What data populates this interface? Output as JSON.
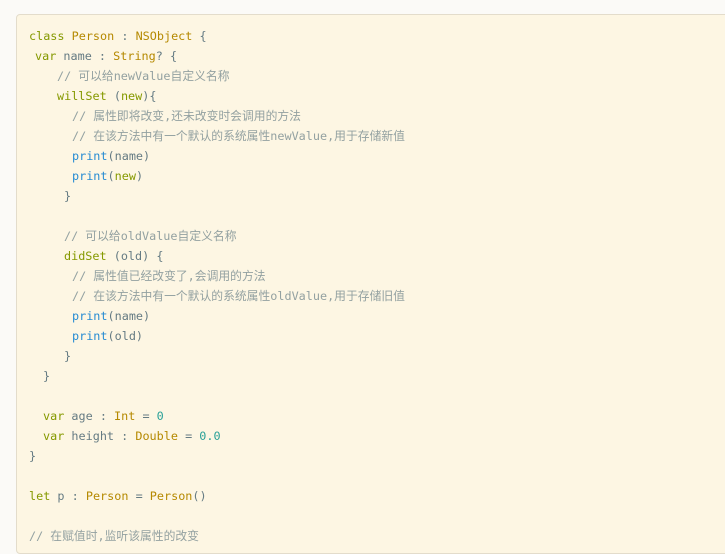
{
  "colors": {
    "keyword": "#859900",
    "type": "#b58900",
    "function": "#268bd2",
    "number": "#2aa198",
    "comment": "#93a1a1",
    "plain": "#657b83",
    "background": "#fdf6e3"
  },
  "code_lines": [
    {
      "indent": 0,
      "tokens": [
        [
          "kw",
          "class "
        ],
        [
          "ty",
          "Person"
        ],
        [
          "pl",
          " : "
        ],
        [
          "ty",
          "NSObject"
        ],
        [
          "pl",
          " {"
        ]
      ]
    },
    {
      "indent": 1,
      "tokens": [
        [
          "kw",
          "var "
        ],
        [
          "pl",
          "name : "
        ],
        [
          "ty",
          "String"
        ],
        [
          "pl",
          "? {"
        ]
      ]
    },
    {
      "indent": 4,
      "tokens": [
        [
          "cm",
          "// 可以给newValue自定义名称"
        ]
      ]
    },
    {
      "indent": 4,
      "tokens": [
        [
          "kw",
          "willSet "
        ],
        [
          "pl",
          "("
        ],
        [
          "kw",
          "new"
        ],
        [
          "pl",
          "){"
        ]
      ]
    },
    {
      "indent": 6,
      "tokens": [
        [
          "cm",
          "// 属性即将改变,还未改变时会调用的方法"
        ]
      ]
    },
    {
      "indent": 6,
      "tokens": [
        [
          "cm",
          "// 在该方法中有一个默认的系统属性newValue,用于存储新值"
        ]
      ]
    },
    {
      "indent": 6,
      "tokens": [
        [
          "fn",
          "print"
        ],
        [
          "pl",
          "(name)"
        ]
      ]
    },
    {
      "indent": 6,
      "tokens": [
        [
          "fn",
          "print"
        ],
        [
          "pl",
          "("
        ],
        [
          "kw",
          "new"
        ],
        [
          "pl",
          ")"
        ]
      ]
    },
    {
      "indent": 5,
      "tokens": [
        [
          "pl",
          "}"
        ]
      ]
    },
    {
      "indent": 0,
      "tokens": []
    },
    {
      "indent": 5,
      "tokens": [
        [
          "cm",
          "// 可以给oldValue自定义名称"
        ]
      ]
    },
    {
      "indent": 5,
      "tokens": [
        [
          "kw",
          "didSet "
        ],
        [
          "pl",
          "(old) {"
        ]
      ]
    },
    {
      "indent": 6,
      "tokens": [
        [
          "cm",
          "// 属性值已经改变了,会调用的方法"
        ]
      ]
    },
    {
      "indent": 6,
      "tokens": [
        [
          "cm",
          "// 在该方法中有一个默认的系统属性oldValue,用于存储旧值"
        ]
      ]
    },
    {
      "indent": 6,
      "tokens": [
        [
          "fn",
          "print"
        ],
        [
          "pl",
          "(name)"
        ]
      ]
    },
    {
      "indent": 6,
      "tokens": [
        [
          "fn",
          "print"
        ],
        [
          "pl",
          "(old)"
        ]
      ]
    },
    {
      "indent": 5,
      "tokens": [
        [
          "pl",
          "}"
        ]
      ]
    },
    {
      "indent": 2,
      "tokens": [
        [
          "pl",
          "}"
        ]
      ]
    },
    {
      "indent": 0,
      "tokens": []
    },
    {
      "indent": 2,
      "tokens": [
        [
          "kw",
          "var "
        ],
        [
          "pl",
          "age : "
        ],
        [
          "ty",
          "Int"
        ],
        [
          "pl",
          " = "
        ],
        [
          "num",
          "0"
        ]
      ]
    },
    {
      "indent": 2,
      "tokens": [
        [
          "kw",
          "var "
        ],
        [
          "pl",
          "height : "
        ],
        [
          "ty",
          "Double"
        ],
        [
          "pl",
          " = "
        ],
        [
          "num",
          "0.0"
        ]
      ]
    },
    {
      "indent": 0,
      "tokens": [
        [
          "pl",
          "}"
        ]
      ]
    },
    {
      "indent": 0,
      "tokens": []
    },
    {
      "indent": 0,
      "tokens": [
        [
          "kw",
          "let "
        ],
        [
          "pl",
          "p : "
        ],
        [
          "ty",
          "Person"
        ],
        [
          "pl",
          " = "
        ],
        [
          "ty",
          "Person"
        ],
        [
          "pl",
          "()"
        ]
      ]
    },
    {
      "indent": 0,
      "tokens": []
    },
    {
      "indent": 0,
      "tokens": [
        [
          "cm",
          "// 在赋值时,监听该属性的改变"
        ]
      ]
    }
  ]
}
